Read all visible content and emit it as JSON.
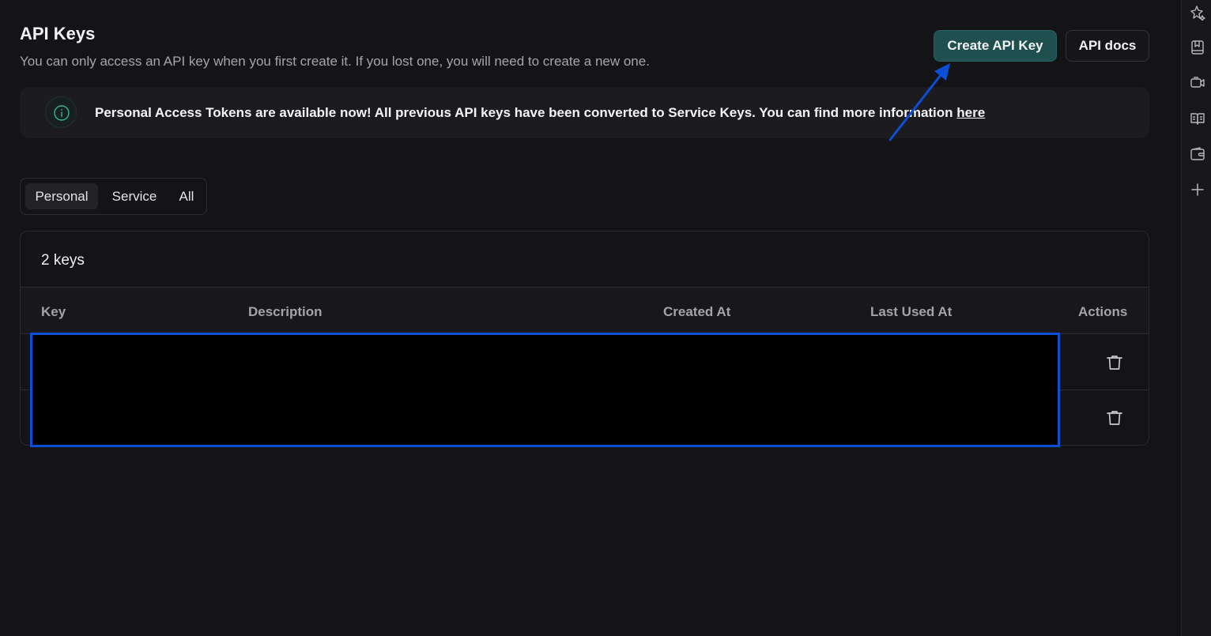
{
  "header": {
    "title": "API Keys",
    "subtitle": "You can only access an API key when you first create it. If you lost one, you will need to create a new one.",
    "create_button": "Create API Key",
    "docs_button": "API docs"
  },
  "banner": {
    "icon": "info-circle-icon",
    "message": "Personal Access Tokens are available now! All previous API keys have been converted to Service Keys. You can find more information ",
    "link_text": "here"
  },
  "tabs": [
    {
      "label": "Personal",
      "active": true
    },
    {
      "label": "Service",
      "active": false
    },
    {
      "label": "All",
      "active": false
    }
  ],
  "table": {
    "count_label": "2 keys",
    "columns": [
      "Key",
      "Description",
      "Created At",
      "Last Used At",
      "Actions"
    ],
    "row_action_icon": "trash-icon"
  },
  "rail_icons": [
    "sparkle-star-icon",
    "bookmark-icon",
    "video-icon",
    "book-icon",
    "wallet-icon",
    "plus-icon"
  ],
  "colors": {
    "background": "#141417",
    "primary_button": "#1f4f4f",
    "accent_teal": "#2fb59b",
    "annotation_blue": "#0a4fd6"
  }
}
